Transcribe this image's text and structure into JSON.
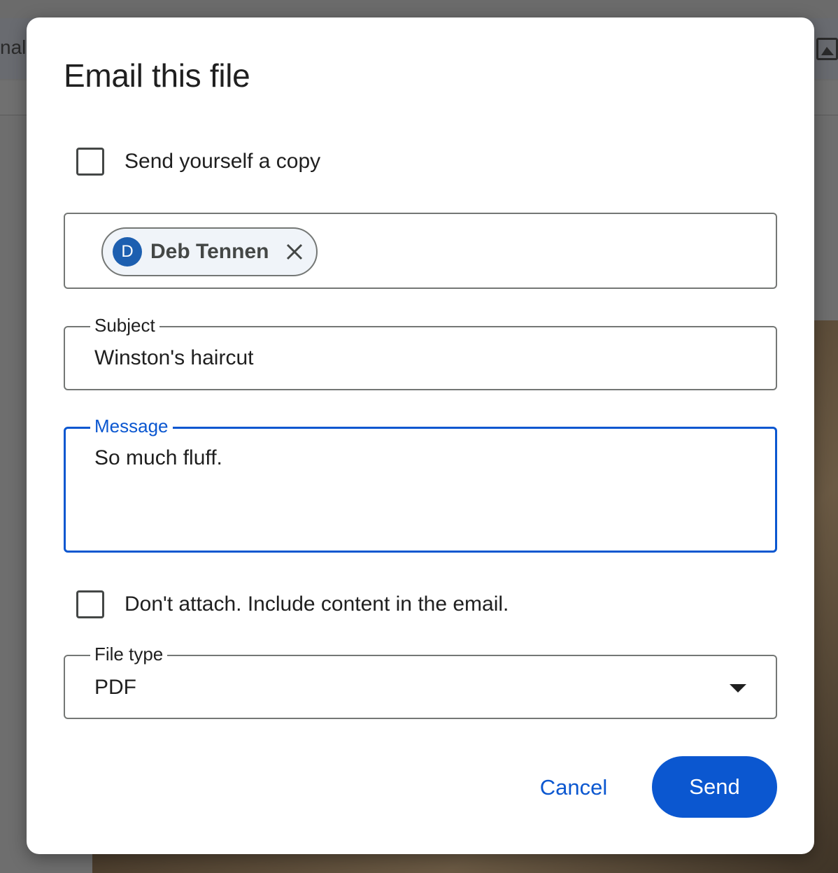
{
  "background": {
    "toolbar_fragment": "nal"
  },
  "dialog": {
    "title": "Email this file",
    "send_copy": {
      "label": "Send yourself a copy",
      "checked": false
    },
    "recipients": [
      {
        "initial": "D",
        "name": "Deb Tennen"
      }
    ],
    "subject": {
      "label": "Subject",
      "value": "Winston's haircut"
    },
    "message": {
      "label": "Message",
      "value": "So much fluff."
    },
    "dont_attach": {
      "label": "Don't attach. Include content in the email.",
      "checked": false
    },
    "file_type": {
      "label": "File type",
      "value": "PDF"
    },
    "buttons": {
      "cancel": "Cancel",
      "send": "Send"
    }
  },
  "colors": {
    "accent": "#0b57d0",
    "avatar": "#1d5fb0",
    "chip_bg": "#f0f4f9"
  },
  "icons": [
    "close-icon",
    "dropdown-arrow-icon",
    "image-icon"
  ]
}
